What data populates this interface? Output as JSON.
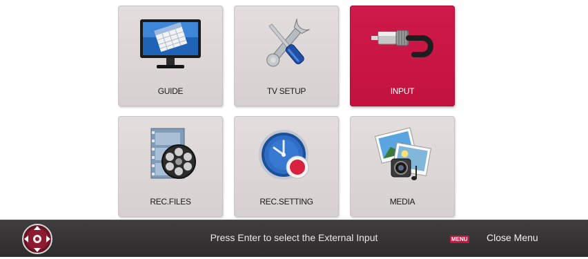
{
  "menu": {
    "tiles": [
      {
        "label": "GUIDE",
        "icon": "guide-monitor-icon",
        "selected": false
      },
      {
        "label": "TV SETUP",
        "icon": "wrench-screwdriver-icon",
        "selected": false
      },
      {
        "label": "INPUT",
        "icon": "av-cable-plug-icon",
        "selected": true
      },
      {
        "label": "REC.FILES",
        "icon": "film-reel-icon",
        "selected": false
      },
      {
        "label": "REC.SETTING",
        "icon": "clock-record-icon",
        "selected": false
      },
      {
        "label": "MEDIA",
        "icon": "photo-music-media-icon",
        "selected": false
      }
    ]
  },
  "footer": {
    "nav_icon": "directional-pad-icon",
    "hint": "Press  Enter  to select the External Input",
    "menu_key": "MENU",
    "close_label": "Close Menu"
  },
  "colors": {
    "selected_tile": "#c8143f",
    "tile": "#dcd6d6",
    "footer": "#363434"
  }
}
